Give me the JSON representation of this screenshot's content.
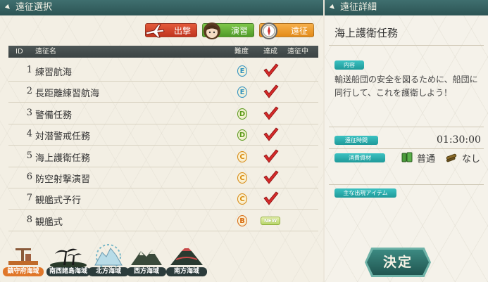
{
  "left_header": {
    "title": "遠征選択"
  },
  "right_header": {
    "title": "遠征詳細"
  },
  "top_buttons": {
    "sortie": "出撃",
    "practice": "演習",
    "expedition": "遠征"
  },
  "table": {
    "columns": {
      "id": "ID",
      "name": "遠征名",
      "difficulty": "難度",
      "achieved": "達成",
      "in_progress": "遠征中"
    },
    "rows": [
      {
        "id": "1",
        "name": "練習航海",
        "difficulty": "E",
        "status": "check"
      },
      {
        "id": "2",
        "name": "長距離練習航海",
        "difficulty": "E",
        "status": "check"
      },
      {
        "id": "3",
        "name": "警備任務",
        "difficulty": "D",
        "status": "check"
      },
      {
        "id": "4",
        "name": "対潜警戒任務",
        "difficulty": "D",
        "status": "check"
      },
      {
        "id": "5",
        "name": "海上護衛任務",
        "difficulty": "C",
        "status": "check"
      },
      {
        "id": "6",
        "name": "防空射撃演習",
        "difficulty": "C",
        "status": "check"
      },
      {
        "id": "7",
        "name": "観艦式予行",
        "difficulty": "C",
        "status": "check"
      },
      {
        "id": "8",
        "name": "観艦式",
        "difficulty": "B",
        "status": "NEW"
      }
    ]
  },
  "sea_areas": [
    {
      "label": "鎮守府海域",
      "icon": "harbor-crane-icon",
      "color": "#e0772a"
    },
    {
      "label": "南西諸島海域",
      "icon": "palm-island-icon",
      "color": "#2b3b3b"
    },
    {
      "label": "北方海域",
      "icon": "iceberg-icon",
      "color": "#2b3b3b"
    },
    {
      "label": "西方海域",
      "icon": "mountain-icon",
      "color": "#2b3b3b"
    },
    {
      "label": "南方海域",
      "icon": "volcano-icon",
      "color": "#2b3b3b"
    }
  ],
  "detail": {
    "title": "海上護衛任務",
    "content_label": "内容",
    "description": "輸送船団の安全を図るために、船団に同行して、これを護衛しよう！",
    "time_label": "遠征時間",
    "time_value": "01:30:00",
    "consumption_label": "消費資材",
    "fuel_text": "普通",
    "ammo_text": "なし",
    "items_label": "主な出現アイテム"
  },
  "decide_button": {
    "label": "決定"
  },
  "colors": {
    "header_teal": "#2c5454",
    "difficulty_E": "#2c8fc0",
    "difficulty_D": "#5a9a1a",
    "difficulty_C": "#d88a10",
    "difficulty_B": "#d86a10",
    "check_red": "#d42a2a"
  }
}
